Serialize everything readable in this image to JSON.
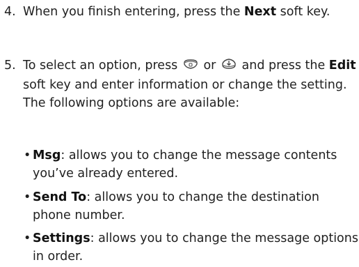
{
  "step4": {
    "number": "4.",
    "text_before": "When you finish entering, press the ",
    "key": "Next",
    "text_after": " soft key."
  },
  "step5": {
    "number": "5.",
    "text_a": "To select an option, press",
    "icon_up": "nav-up-key-icon",
    "text_or": "or",
    "icon_down": "nav-down-key-icon",
    "text_b": "and press the ",
    "key": "Edit",
    "text_c": " soft key and enter information or change the setting. The following options are available:"
  },
  "bullets": [
    {
      "dot": "•",
      "term": "Msg",
      "desc": ": allows you to change the message contents you’ve already entered."
    },
    {
      "dot": "•",
      "term": "Send To",
      "desc": ": allows you to change the destination phone number."
    },
    {
      "dot": "•",
      "term": "Settings",
      "desc": ": allows you to change the message options in order."
    }
  ],
  "colors": {
    "text": "#1f1f1f",
    "icon": "#444444"
  }
}
